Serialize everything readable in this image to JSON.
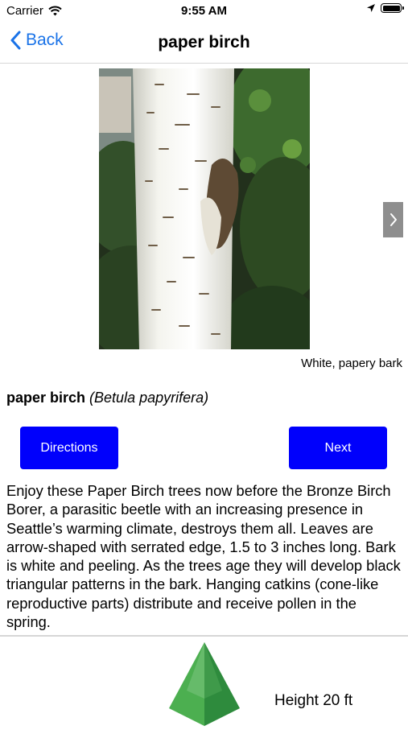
{
  "status_bar": {
    "carrier": "Carrier",
    "time": "9:55 AM"
  },
  "nav": {
    "back_label": "Back",
    "title": "paper birch"
  },
  "photo": {
    "caption": "White, papery bark"
  },
  "tree": {
    "common_name": "paper birch",
    "latin_name": "(Betula papyrifera)"
  },
  "buttons": {
    "directions": "Directions",
    "next": "Next"
  },
  "description": "Enjoy these Paper Birch trees now before the Bronze Birch Borer, a parasitic beetle with an increasing presence in Seattle’s warming climate, destroys them all. Leaves are arrow-shaped with serrated edge, 1.5 to 3 inches long. Bark is white and peeling.  As the trees age they will develop black triangular patterns in the bark. Hanging catkins (cone-like reproductive parts) distribute and receive pollen in the spring.",
  "height": {
    "label": "Height 20 ft"
  },
  "colors": {
    "accent": "#1a73e8",
    "button": "#0000fc",
    "tree_icon": "#4caf50"
  },
  "icons": [
    "wifi-icon",
    "location-arrow-icon",
    "battery-icon",
    "chevron-left-icon",
    "chevron-right-icon",
    "tree-icon"
  ]
}
